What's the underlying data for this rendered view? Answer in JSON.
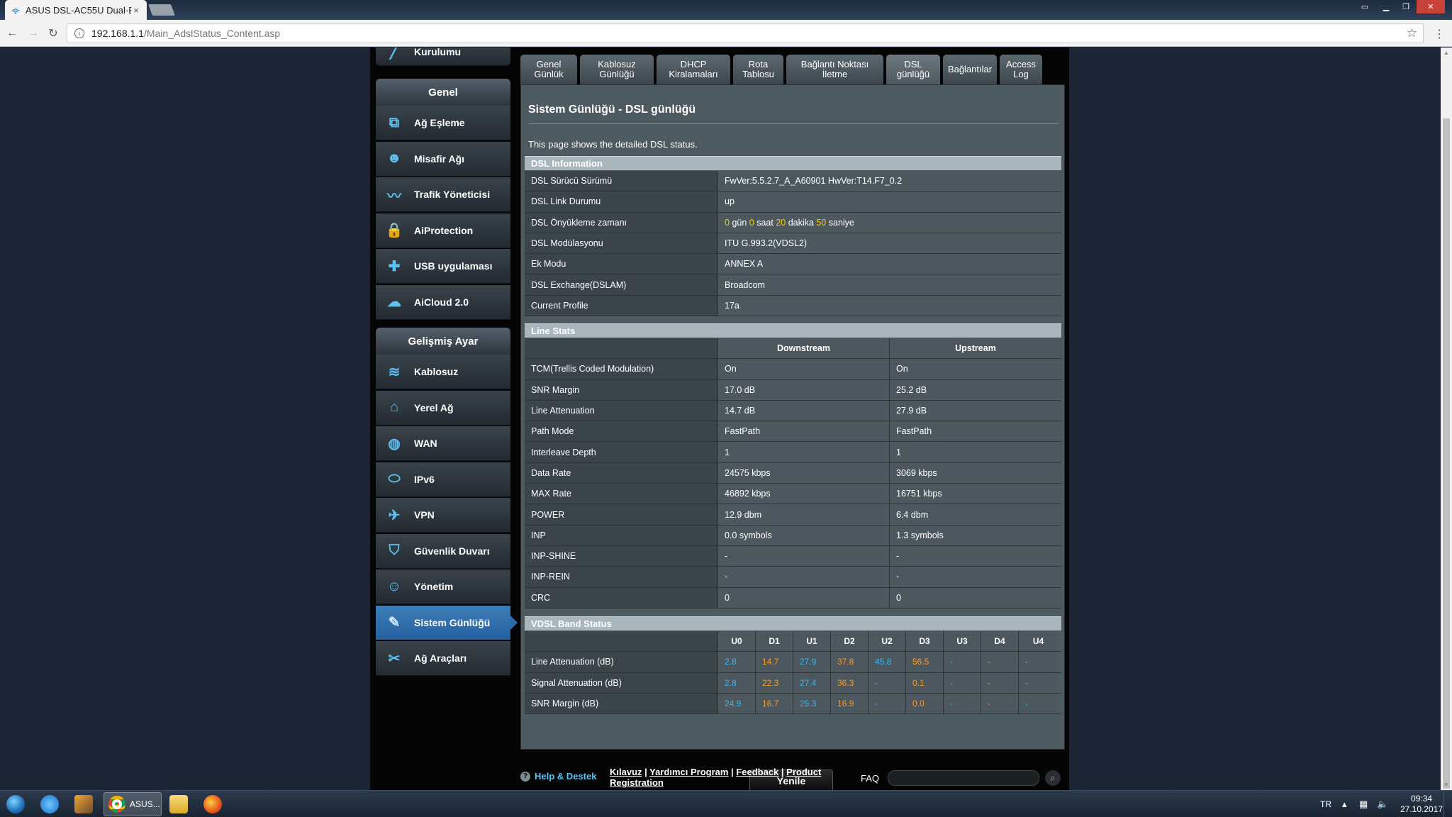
{
  "browser": {
    "tab_title": "ASUS DSL-AC55U Dual-E",
    "tab_close": "×",
    "url_host": "192.168.1.1",
    "url_path": "/Main_AdslStatus_Content.asp",
    "info_icon": "i",
    "star": "☆",
    "menu": "⋮"
  },
  "sidebar": {
    "top_item": "Kurulumu",
    "general_head": "Genel",
    "general_items": [
      {
        "label": "Ağ Eşleme",
        "icon": "network-map-icon"
      },
      {
        "label": "Misafir Ağı",
        "icon": "guest-network-icon"
      },
      {
        "label": "Trafik Yöneticisi",
        "icon": "traffic-manager-icon"
      },
      {
        "label": "AiProtection",
        "icon": "lock-icon"
      },
      {
        "label": "USB uygulaması",
        "icon": "puzzle-icon"
      },
      {
        "label": "AiCloud 2.0",
        "icon": "cloud-icon"
      }
    ],
    "advanced_head": "Gelişmiş Ayar",
    "advanced_items": [
      {
        "label": "Kablosuz",
        "icon": "wifi-icon"
      },
      {
        "label": "Yerel Ağ",
        "icon": "home-icon"
      },
      {
        "label": "WAN",
        "icon": "globe-icon"
      },
      {
        "label": "IPv6",
        "icon": "ipv6-icon"
      },
      {
        "label": "VPN",
        "icon": "vpn-icon"
      },
      {
        "label": "Güvenlik Duvarı",
        "icon": "shield-icon"
      },
      {
        "label": "Yönetim",
        "icon": "user-icon"
      },
      {
        "label": "Sistem Günlüğü",
        "icon": "log-edit-icon"
      },
      {
        "label": "Ağ Araçları",
        "icon": "tools-icon"
      }
    ]
  },
  "tabs": [
    {
      "line1": "Genel",
      "line2": "Günlük"
    },
    {
      "line1": "Kablosuz",
      "line2": "Günlüğü"
    },
    {
      "line1": "DHCP",
      "line2": "Kiralamaları"
    },
    {
      "line1": "Rota",
      "line2": "Tablosu"
    },
    {
      "line1": "Bağlantı Noktası",
      "line2": "İletme"
    },
    {
      "line1": "DSL",
      "line2": "günlüğü"
    },
    {
      "line1": "Bağlantılar",
      "line2": ""
    },
    {
      "line1": "Access",
      "line2": "Log"
    }
  ],
  "page": {
    "title": "Sistem Günlüğü - DSL günlüğü",
    "description": "This page shows the detailed DSL status."
  },
  "dsl_info": {
    "head": "DSL Information",
    "rows": [
      {
        "label": "DSL Sürücü Sürümü",
        "value": "FwVer:5.5.2.7_A_A60901 HwVer:T14.F7_0.2"
      },
      {
        "label": "DSL Link Durumu",
        "value": "up"
      },
      {
        "label": "DSL Önyükleme zamanı",
        "uptime": {
          "days": "0",
          "days_unit": "gün",
          "hours": "0",
          "hours_unit": "saat",
          "minutes": "20",
          "minutes_unit": "dakika",
          "seconds": "50",
          "seconds_unit": "saniye"
        }
      },
      {
        "label": "DSL Modülasyonu",
        "value": "ITU G.993.2(VDSL2)"
      },
      {
        "label": "Ek Modu",
        "value": "ANNEX A"
      },
      {
        "label": "DSL Exchange(DSLAM)",
        "value": "Broadcom"
      },
      {
        "label": "Current Profile",
        "value": "17a"
      }
    ]
  },
  "line_stats": {
    "head": "Line Stats",
    "col_down": "Downstream",
    "col_up": "Upstream",
    "rows": [
      {
        "label": "TCM(Trellis Coded Modulation)",
        "down": "On",
        "up": "On"
      },
      {
        "label": "SNR Margin",
        "down": "17.0 dB",
        "up": "25.2 dB"
      },
      {
        "label": "Line Attenuation",
        "down": "14.7 dB",
        "up": "27.9 dB"
      },
      {
        "label": "Path Mode",
        "down": "FastPath",
        "up": "FastPath"
      },
      {
        "label": "Interleave Depth",
        "down": "1",
        "up": "1"
      },
      {
        "label": "Data Rate",
        "down": "24575 kbps",
        "up": "3069 kbps"
      },
      {
        "label": "MAX Rate",
        "down": "46892 kbps",
        "up": "16751 kbps"
      },
      {
        "label": "POWER",
        "down": "12.9 dbm",
        "up": "6.4 dbm"
      },
      {
        "label": "INP",
        "down": "0.0 symbols",
        "up": "1.3 symbols"
      },
      {
        "label": "INP-SHINE",
        "down": "-",
        "up": "-"
      },
      {
        "label": "INP-REIN",
        "down": "-",
        "up": "-"
      },
      {
        "label": "CRC",
        "down": "0",
        "up": "0"
      }
    ]
  },
  "vdsl_band": {
    "head": "VDSL Band Status",
    "bands": [
      "U0",
      "D1",
      "U1",
      "D2",
      "U2",
      "D3",
      "U3",
      "D4",
      "U4"
    ],
    "rows": [
      {
        "label": "Line Attenuation (dB)",
        "values": [
          "2.8",
          "14.7",
          "27.9",
          "37.8",
          "45.8",
          "56.5",
          "-",
          "-",
          "-"
        ]
      },
      {
        "label": "Signal Attenuation (dB)",
        "values": [
          "2.8",
          "22.3",
          "27.4",
          "36.3",
          "-",
          "0.1",
          "-",
          "-",
          "-"
        ]
      },
      {
        "label": "SNR Margin (dB)",
        "values": [
          "24.9",
          "16.7",
          "25.3",
          "16.9",
          "-",
          "0.0",
          "-",
          "-",
          "-"
        ]
      }
    ],
    "up_color": "#35b9f2",
    "down_color": "#f39c32"
  },
  "refresh_label": "Yenile",
  "footer": {
    "help": "Help & Destek",
    "help_icon": "?",
    "link1": "Kılavuz",
    "sep": " | ",
    "link2": "Yardımcı Program",
    "link3": "Feedback",
    "link4": "Product Registration",
    "faq": "FAQ",
    "search_icon": "⌕"
  },
  "taskbar": {
    "chrome_label": "ASUS...",
    "lang": "TR",
    "time": "09:34",
    "date": "27.10.2017"
  }
}
